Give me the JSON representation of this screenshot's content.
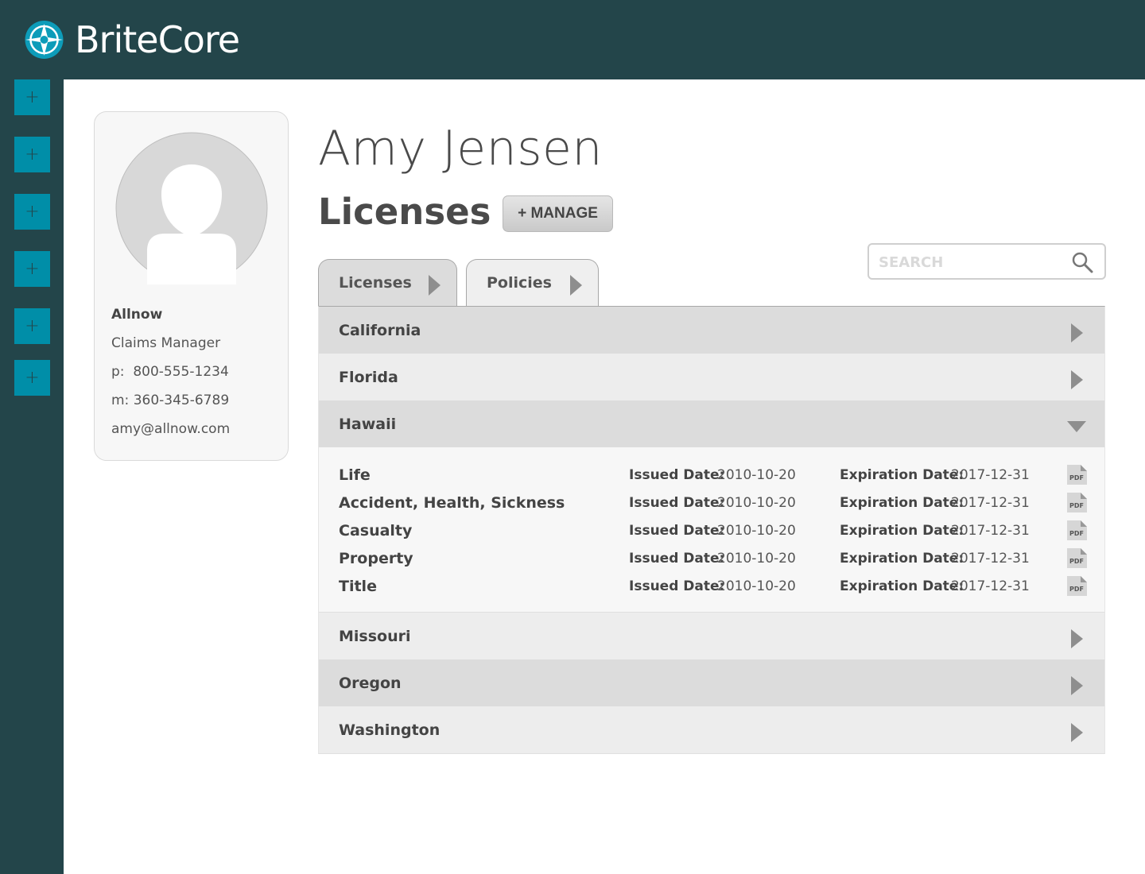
{
  "brand": {
    "name": "BriteCore"
  },
  "profile": {
    "company": "Allnow",
    "role": "Claims Manager",
    "phone_label": "p:",
    "phone": "800-555-1234",
    "mobile_label": "m:",
    "mobile": "360-345-6789",
    "email": "amy@allnow.com"
  },
  "page": {
    "person_name": "Amy Jensen",
    "section_title": "Licenses",
    "manage_label": "+ MANAGE"
  },
  "search": {
    "placeholder": "SEARCH"
  },
  "tabs": [
    {
      "label": "Licenses",
      "active": true
    },
    {
      "label": "Policies",
      "active": false
    }
  ],
  "states": [
    {
      "name": "California",
      "expanded": false
    },
    {
      "name": "Florida",
      "expanded": false
    },
    {
      "name": "Hawaii",
      "expanded": true
    },
    {
      "name": "Missouri",
      "expanded": false
    },
    {
      "name": "Oregon",
      "expanded": false
    },
    {
      "name": "Washington",
      "expanded": false
    }
  ],
  "license_labels": {
    "issued": "Issued Date:",
    "expiration": "Expiration Date:",
    "pdf": "PDF"
  },
  "hawaii_licenses": [
    {
      "name": "Life",
      "issued": "2010-10-20",
      "expiration": "2017-12-31"
    },
    {
      "name": "Accident, Health, Sickness",
      "issued": "2010-10-20",
      "expiration": "2017-12-31"
    },
    {
      "name": "Casualty",
      "issued": "2010-10-20",
      "expiration": "2017-12-31"
    },
    {
      "name": "Property",
      "issued": "2010-10-20",
      "expiration": "2017-12-31"
    },
    {
      "name": "Title",
      "issued": "2010-10-20",
      "expiration": "2017-12-31"
    }
  ],
  "colors": {
    "topbar": "#23454a",
    "sidebar_button": "#008ea8",
    "row_dark": "#dcdcdc",
    "row_light": "#ededed"
  },
  "sidebar": {
    "buttons": [
      "+",
      "+",
      "+",
      "+",
      "+",
      "+"
    ]
  }
}
